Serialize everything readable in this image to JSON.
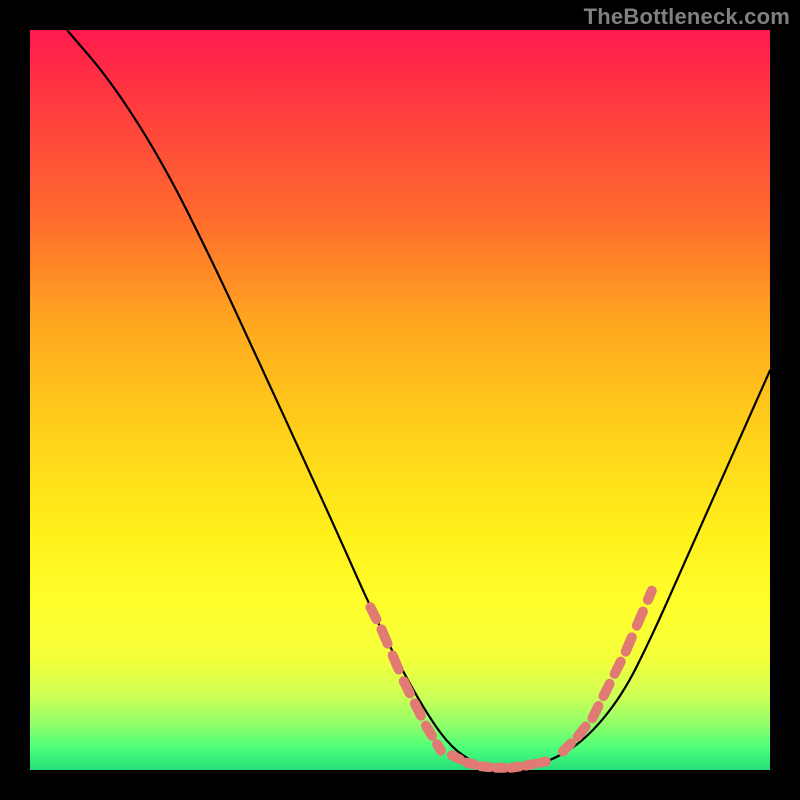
{
  "watermark": "TheBottleneck.com",
  "colors": {
    "background": "#000000",
    "watermark": "#808080",
    "curve": "#000000",
    "dots": "#e27a74",
    "gradient_top": "#ff1a4d",
    "gradient_bottom": "#24e07a"
  },
  "chart_data": {
    "type": "line",
    "title": "",
    "xlabel": "",
    "ylabel": "",
    "xlim": [
      0,
      100
    ],
    "ylim": [
      0,
      100
    ],
    "grid": false,
    "legend": false,
    "series": [
      {
        "name": "bottleneck-curve",
        "x": [
          5,
          11,
          18,
          25,
          31,
          37,
          42,
          46,
          50,
          54,
          57,
          60,
          62,
          65,
          70,
          75,
          80,
          84,
          88,
          92,
          96,
          100
        ],
        "y": [
          100,
          93,
          82,
          68,
          55,
          42,
          31,
          22,
          14,
          7,
          3,
          1,
          0,
          0,
          1,
          4,
          10,
          18,
          27,
          36,
          45,
          54
        ]
      }
    ],
    "highlight_segments": [
      {
        "name": "left-descent-dots",
        "points_xy": [
          [
            46,
            22
          ],
          [
            47.5,
            19
          ],
          [
            49,
            15.5
          ],
          [
            50.5,
            12
          ],
          [
            52,
            9
          ],
          [
            53.5,
            6
          ],
          [
            55,
            3.5
          ]
        ]
      },
      {
        "name": "valley-dots",
        "points_xy": [
          [
            57,
            2
          ],
          [
            59,
            1
          ],
          [
            61,
            0.5
          ],
          [
            63,
            0.3
          ],
          [
            65,
            0.3
          ],
          [
            67,
            0.6
          ],
          [
            69,
            1
          ]
        ]
      },
      {
        "name": "right-ascent-dots",
        "points_xy": [
          [
            72,
            2.5
          ],
          [
            74,
            4.5
          ],
          [
            76,
            7
          ],
          [
            77.5,
            10
          ],
          [
            79,
            13
          ],
          [
            80.5,
            16
          ],
          [
            82,
            19.5
          ],
          [
            83.5,
            23
          ]
        ]
      }
    ]
  }
}
